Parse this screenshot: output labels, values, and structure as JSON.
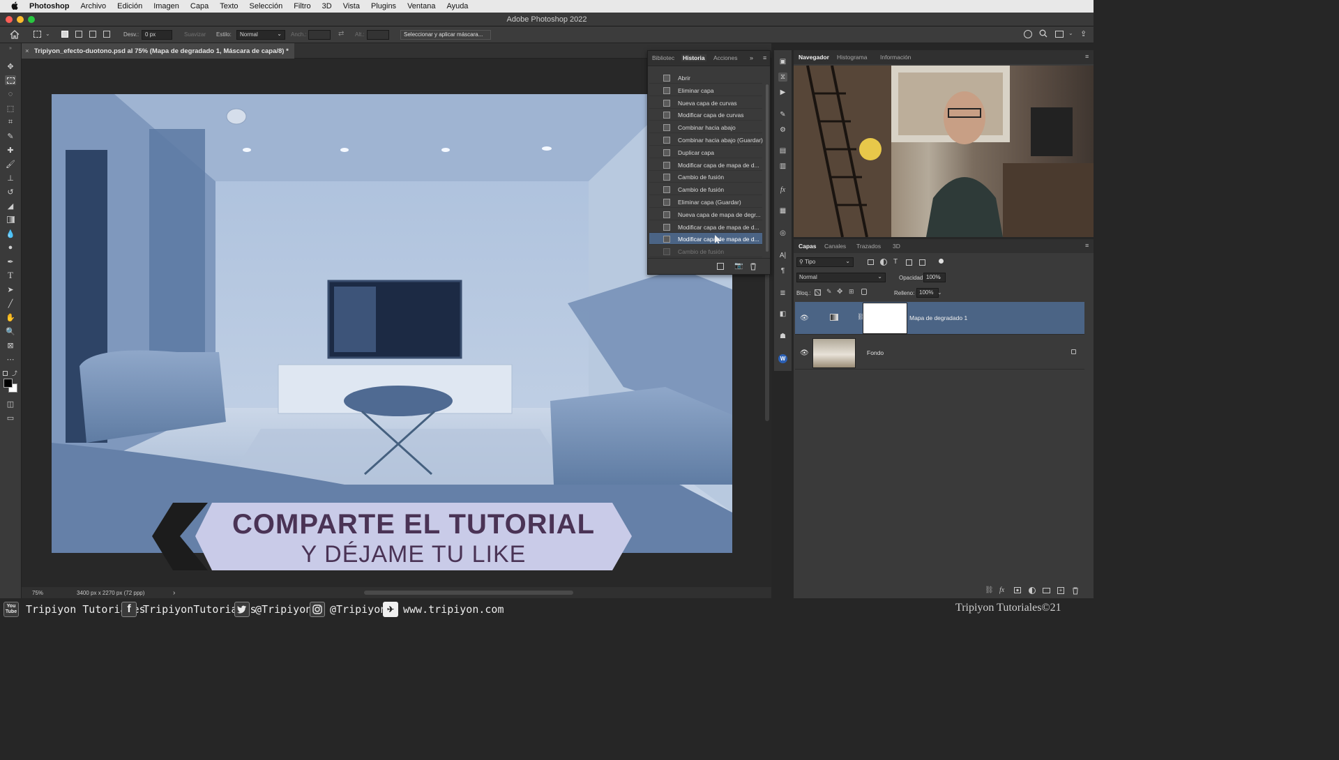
{
  "menubar": {
    "apple": "",
    "app": "Photoshop",
    "items": [
      "Archivo",
      "Edición",
      "Imagen",
      "Capa",
      "Texto",
      "Selección",
      "Filtro",
      "3D",
      "Vista",
      "Plugins",
      "Ventana",
      "Ayuda"
    ]
  },
  "window": {
    "title": "Adobe Photoshop 2022"
  },
  "options": {
    "feather_label": "Desv.:",
    "feather_value": "0 px",
    "smooth_label": "Suavizar",
    "style_label": "Estilo:",
    "style_value": "Normal",
    "width_label": "Anch.:",
    "height_label": "Alt.:",
    "select_mask_button": "Seleccionar y aplicar máscara..."
  },
  "document": {
    "tab_title": "Tripiyon_efecto-duotono.psd al 75% (Mapa de degradado 1, Máscara de capa/8) *",
    "zoom": "75%",
    "size_info": "3400 px x 2270 px (72 ppp)",
    "status_arrow": "›"
  },
  "history_panel": {
    "tabs": [
      "Bibliotec",
      "Historia",
      "Acciones"
    ],
    "active_tab": "Historia",
    "items": [
      "Abrir",
      "Eliminar capa",
      "Nueva capa de curvas",
      "Modificar capa de curvas",
      "Combinar hacia abajo",
      "Combinar hacia abajo (Guardar)",
      "Duplicar capa",
      "Modificar capa de mapa de d...",
      "Cambio de fusión",
      "Cambio de fusión",
      "Eliminar capa (Guardar)",
      "Nueva capa de mapa de degr...",
      "Modificar capa de mapa de d...",
      "Modificar capa de mapa de d...",
      "Cambio de fusión"
    ],
    "selected_index": 13,
    "dimmed_index": 14
  },
  "navigator_panel": {
    "tabs": [
      "Navegador",
      "Histograma",
      "Información"
    ],
    "active_tab": "Navegador"
  },
  "layers_panel": {
    "tabs": [
      "Capas",
      "Canales",
      "Trazados",
      "3D"
    ],
    "active_tab": "Capas",
    "filter_value": "Tipo",
    "blend_mode": "Normal",
    "opacity_label": "Opacidad:",
    "opacity_value": "100%",
    "lock_label": "Bloq.:",
    "fill_label": "Relleno:",
    "fill_value": "100%",
    "layers": [
      {
        "name": "Mapa de degradado 1"
      },
      {
        "name": "Fondo"
      }
    ]
  },
  "banner": {
    "line1": "COMPARTE EL TUTORIAL",
    "line2": "Y DÉJAME TU LIKE"
  },
  "social_bar": {
    "youtube_label": "Tripiyon Tutoriales",
    "facebook_label": "TripiyonTutoriales",
    "twitter_label": "@Tripiyon",
    "instagram_label": "@Tripiyon",
    "web_label": "www.tripiyon.com",
    "watermark": "Tripiyon Tutoriales©21",
    "youtube_icon_text": "You Tube"
  },
  "colors": {
    "accent_selection": "#4b6485",
    "banner_bg": "#c9cbe8",
    "banner_text": "#4a3355",
    "image_tint": "#a9bedb"
  }
}
